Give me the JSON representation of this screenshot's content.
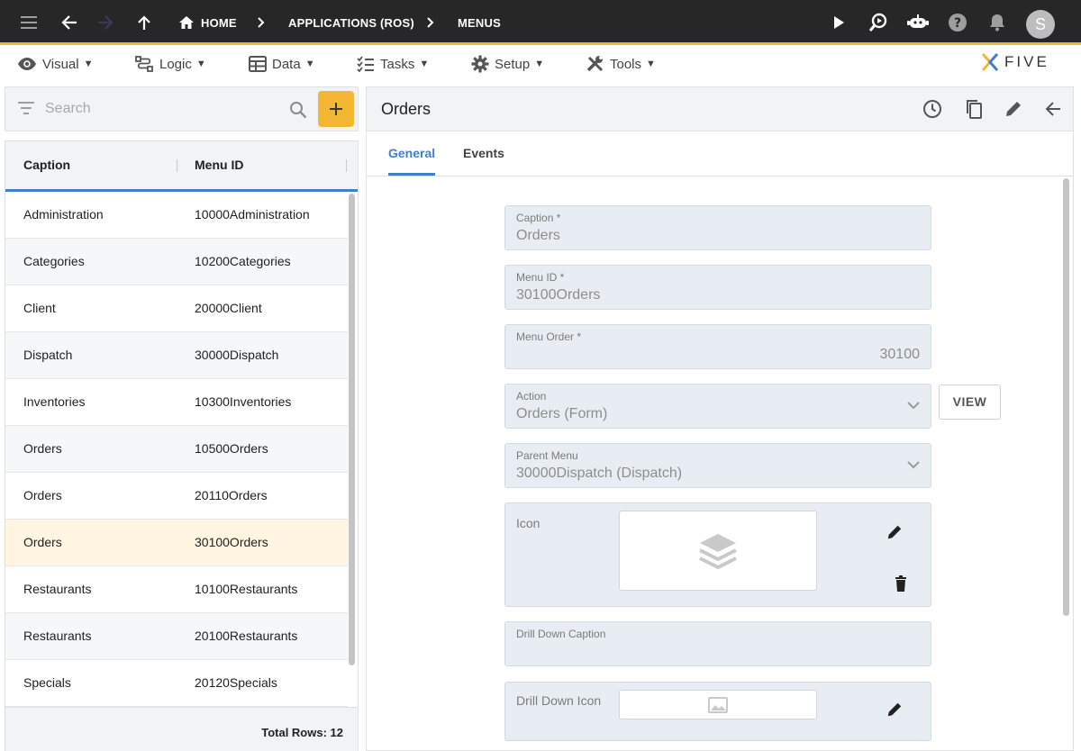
{
  "nav": {
    "breadcrumb": [
      "HOME",
      "APPLICATIONS (ROS)",
      "MENUS"
    ],
    "avatar_initial": "S"
  },
  "menubar": {
    "items": [
      "Visual",
      "Logic",
      "Data",
      "Tasks",
      "Setup",
      "Tools"
    ],
    "caret": "▼",
    "logo_text": "FIVE"
  },
  "search": {
    "placeholder": "Search"
  },
  "list": {
    "columns": [
      "Caption",
      "Menu ID"
    ],
    "rows": [
      {
        "caption": "Administration",
        "menu_id": "10000Administration"
      },
      {
        "caption": "Categories",
        "menu_id": "10200Categories"
      },
      {
        "caption": "Client",
        "menu_id": "20000Client"
      },
      {
        "caption": "Dispatch",
        "menu_id": "30000Dispatch"
      },
      {
        "caption": "Inventories",
        "menu_id": "10300Inventories"
      },
      {
        "caption": "Orders",
        "menu_id": "10500Orders"
      },
      {
        "caption": "Orders",
        "menu_id": "20110Orders"
      },
      {
        "caption": "Orders",
        "menu_id": "30100Orders"
      },
      {
        "caption": "Restaurants",
        "menu_id": "10100Restaurants"
      },
      {
        "caption": "Restaurants",
        "menu_id": "20100Restaurants"
      },
      {
        "caption": "Specials",
        "menu_id": "20120Specials"
      }
    ],
    "selected_index": 7,
    "total_label": "Total Rows: 12"
  },
  "detail": {
    "title": "Orders",
    "tabs": [
      "General",
      "Events"
    ],
    "active_tab": "General",
    "fields": {
      "caption": {
        "label": "Caption *",
        "value": "Orders"
      },
      "menu_id": {
        "label": "Menu ID *",
        "value": "30100Orders"
      },
      "menu_order": {
        "label": "Menu Order *",
        "value": "30100"
      },
      "action": {
        "label": "Action",
        "value": "Orders (Form)"
      },
      "parent_menu": {
        "label": "Parent Menu",
        "value": "30000Dispatch (Dispatch)"
      },
      "icon": {
        "label": "Icon"
      },
      "drill_down_caption": {
        "label": "Drill Down Caption",
        "value": ""
      },
      "drill_down_icon": {
        "label": "Drill Down Icon"
      }
    },
    "view_button": "VIEW"
  },
  "colors": {
    "topbar": "#272727",
    "accent": "#f2b636",
    "primary": "#3f7fcc",
    "field_bg": "#e8edf3",
    "selected_row": "#fff5e1"
  }
}
